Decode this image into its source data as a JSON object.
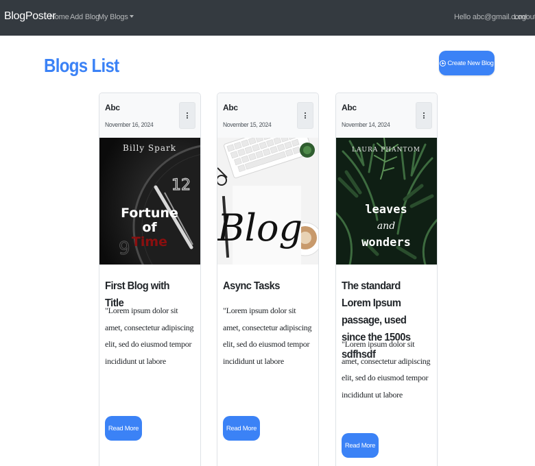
{
  "navbar": {
    "brand": "BlogPoster",
    "links": [
      "Home",
      "Add Blog",
      "My Blogs"
    ],
    "greeting": "Hello abc@gmail.com!",
    "logout": "Logout"
  },
  "page": {
    "title": "Blogs List",
    "create_button": "Create New Blog"
  },
  "colors": {
    "navbar_bg": "#343a40",
    "accent": "#3b82f6"
  },
  "posts": [
    {
      "author": "Abc",
      "date": "November 16, 2024",
      "title": "First Blog with Title",
      "excerpt": "\"Lorem ipsum dolor sit amet, consectetur adipiscing elit, sed do eiusmod tempor incididunt ut labore",
      "read_more": "Read More",
      "image": {
        "top_text": "Billy Spark",
        "line1": "Fortune",
        "line2": "of",
        "line3": "Time",
        "clock_number": "12"
      }
    },
    {
      "author": "Abc",
      "date": "November 15, 2024",
      "title": "Async Tasks",
      "excerpt": "\"Lorem ipsum dolor sit amet, consectetur adipiscing elit, sed do eiusmod tempor incididunt ut labore",
      "read_more": "Read More",
      "image": {
        "script_text": "Blog"
      }
    },
    {
      "author": "Abc",
      "date": "November 14, 2024",
      "title": "The standard Lorem Ipsum passage, used since the 1500s sdfhsdf",
      "excerpt": "\"Lorem ipsum dolor sit amet, consectetur adipiscing elit, sed do eiusmod tempor incididunt ut labore",
      "read_more": "Read More",
      "image": {
        "top_text": "LAURA PHANTOM",
        "line1": "leaves",
        "line2": "and",
        "line3": "wonders"
      }
    }
  ]
}
